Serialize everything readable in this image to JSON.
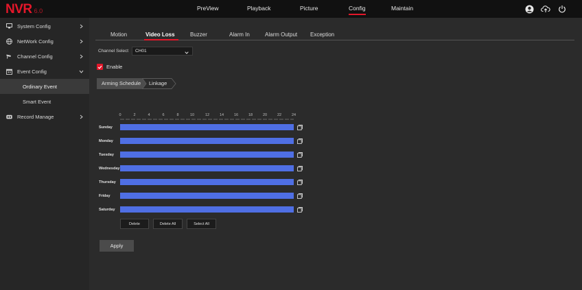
{
  "app": {
    "logo": "NVR",
    "version": "6.0"
  },
  "topnav": [
    {
      "label": "PreView"
    },
    {
      "label": "Playback"
    },
    {
      "label": "Picture"
    },
    {
      "label": "Config",
      "active": true
    },
    {
      "label": "Maintain"
    }
  ],
  "top_icons": [
    "user-avatar-icon",
    "cloud-upload-icon",
    "power-icon"
  ],
  "sidebar": {
    "items": [
      {
        "label": "System Config",
        "icon": "monitor-icon",
        "expanded": false
      },
      {
        "label": "NetWork Config",
        "icon": "globe-icon",
        "expanded": false
      },
      {
        "label": "Channel Config",
        "icon": "camera-icon",
        "expanded": false
      },
      {
        "label": "Event Config",
        "icon": "calendar-icon",
        "expanded": true
      },
      {
        "label": "Record Manage",
        "icon": "record-icon",
        "expanded": false
      }
    ],
    "sub_items": [
      {
        "label": "Ordinary Event",
        "active": true
      },
      {
        "label": "Smart Event",
        "active": false
      }
    ]
  },
  "tabs": [
    {
      "label": "Motion"
    },
    {
      "label": "Video Loss",
      "active": true
    },
    {
      "label": "Buzzer"
    },
    {
      "label": "Alarm In"
    },
    {
      "label": "Alarm Output"
    },
    {
      "label": "Exception"
    }
  ],
  "channel_select": {
    "label": "Channel Select",
    "value": "CH01"
  },
  "enable": {
    "label": "Enable",
    "checked": true
  },
  "subtabs": [
    {
      "label": "Arming Schedule",
      "active": true
    },
    {
      "label": "Linkage",
      "active": false
    }
  ],
  "schedule": {
    "hours": [
      "0",
      "2",
      "4",
      "6",
      "8",
      "10",
      "12",
      "14",
      "16",
      "18",
      "20",
      "22",
      "24"
    ],
    "days": [
      "Sunday",
      "Monday",
      "Tuesday",
      "Wednesday",
      "Thursday",
      "Friday",
      "Saturday"
    ],
    "coverage": [
      [
        0,
        24
      ],
      [
        0,
        24
      ],
      [
        0,
        24
      ],
      [
        0,
        24
      ],
      [
        0,
        24
      ],
      [
        0,
        24
      ],
      [
        0,
        24
      ]
    ]
  },
  "buttons": {
    "delete": "Delete",
    "delete_all": "Delete All",
    "select_all": "Select All",
    "apply": "Apply"
  },
  "colors": {
    "accent": "#e4172a",
    "schedule_bar": "#4f6fe4",
    "topbar": "#111111",
    "sidebar": "#262626",
    "main": "#2b2b2b"
  }
}
